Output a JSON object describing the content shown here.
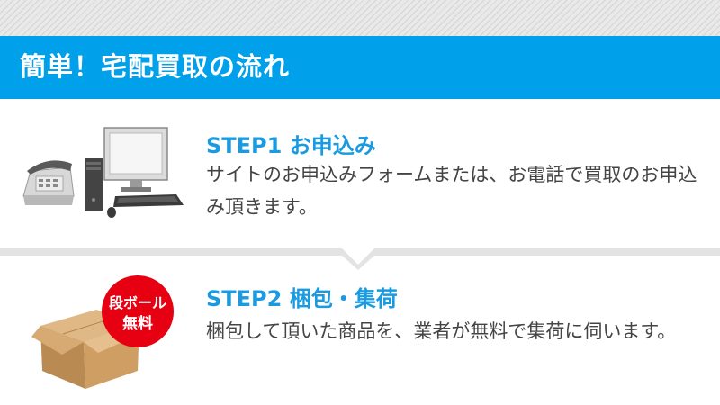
{
  "header": {
    "title": "簡単！宅配買取の流れ"
  },
  "steps": [
    {
      "title": "STEP1 お申込み",
      "description": "サイトのお申込みフォームまたは、お電話で買取のお申込み頂きます。",
      "icon": "phone-computer-icon"
    },
    {
      "title": "STEP2 梱包・集荷",
      "description": "梱包して頂いた商品を、業者が無料で集荷に伺います。",
      "icon": "cardboard-box-icon",
      "badge": {
        "line1": "段ボール",
        "line2": "無料"
      }
    }
  ],
  "colors": {
    "header_bg": "#00a0ea",
    "step_title": "#1a9ae0",
    "badge": "#e60012"
  }
}
